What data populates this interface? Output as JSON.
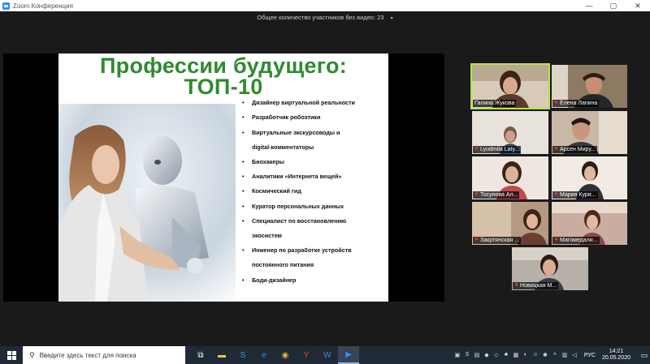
{
  "window": {
    "title": "Zoom Конференция",
    "controls": [
      "—",
      "▢",
      "✕"
    ]
  },
  "header": {
    "participants_text": "Общее количество участников без видео: 23",
    "caret": "▾"
  },
  "slide": {
    "title_line1": "Профессии будущего:",
    "title_line2": "ТОП-10",
    "items": [
      {
        "l1": "Дизайнер виртуальной реальности"
      },
      {
        "l1": "Разработчик робоэтики"
      },
      {
        "l1": "Виртуальные экскурсоводы и",
        "l2": "digital-комментаторы"
      },
      {
        "l1": "Биохакеры"
      },
      {
        "l1": "Аналитики «Интернета вещей»"
      },
      {
        "l1": "Космический гид"
      },
      {
        "l1": "Куратор персональных данных"
      },
      {
        "l1": "Специалист по восстановлению",
        "l2": "экосистем"
      },
      {
        "l1": "Инженер по разработке устройств",
        "l2": "постоянного питания"
      },
      {
        "l1": "Боди-дизайнер"
      }
    ],
    "bullet": "•"
  },
  "participants": [
    {
      "name": "Галина Жукова",
      "muted": false,
      "active": true
    },
    {
      "name": "Елена Лапина",
      "muted": true
    },
    {
      "name": "Lyudmila Laty...",
      "muted": true
    },
    {
      "name": "Арсен Миру...",
      "muted": true
    },
    {
      "name": "Тосунова Ал...",
      "muted": true
    },
    {
      "name": "Мария Кури...",
      "muted": true
    },
    {
      "name": "Закртянская ...",
      "muted": true
    },
    {
      "name": "Магомедали...",
      "muted": true
    },
    {
      "name": "Новицкая М...",
      "muted": true
    }
  ],
  "taskbar": {
    "search_placeholder": "Введите здесь текст для поиска",
    "language": "РУС",
    "time": "14:21",
    "date": "20.05.2020"
  }
}
